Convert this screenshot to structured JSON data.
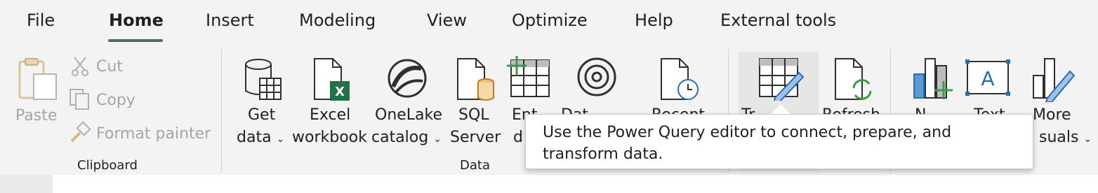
{
  "menu": {
    "tabs": [
      "File",
      "Home",
      "Insert",
      "Modeling",
      "View",
      "Optimize",
      "Help",
      "External tools"
    ],
    "active": "Home"
  },
  "clipboard": {
    "paste": "Paste",
    "cut": "Cut",
    "copy": "Copy",
    "format_painter": "Format painter",
    "group": "Clipboard"
  },
  "data": {
    "get_data": [
      "Get",
      "data"
    ],
    "excel": [
      "Excel",
      "workbook"
    ],
    "onelake": [
      "OneLake",
      "catalog"
    ],
    "sql": [
      "SQL",
      "Server"
    ],
    "enter_data": [
      "Ent",
      "d"
    ],
    "dataverse": [
      "Dat"
    ],
    "recent": [
      "Recent"
    ],
    "group": "Data"
  },
  "queries": {
    "transform": [
      "Tr"
    ],
    "refresh": [
      "Refresh"
    ]
  },
  "insert": {
    "new_visual": [
      "N"
    ],
    "text_box": [
      "Text"
    ],
    "more_visuals": [
      "More",
      "suals"
    ]
  },
  "tooltip": {
    "text": "Use the Power Query editor to connect, prepare, and transform data."
  },
  "colors": {
    "accent": "#3c7a5a",
    "excel_green": "#217346",
    "blue": "#2b6cb0",
    "disabled": "#a5a5a5"
  }
}
